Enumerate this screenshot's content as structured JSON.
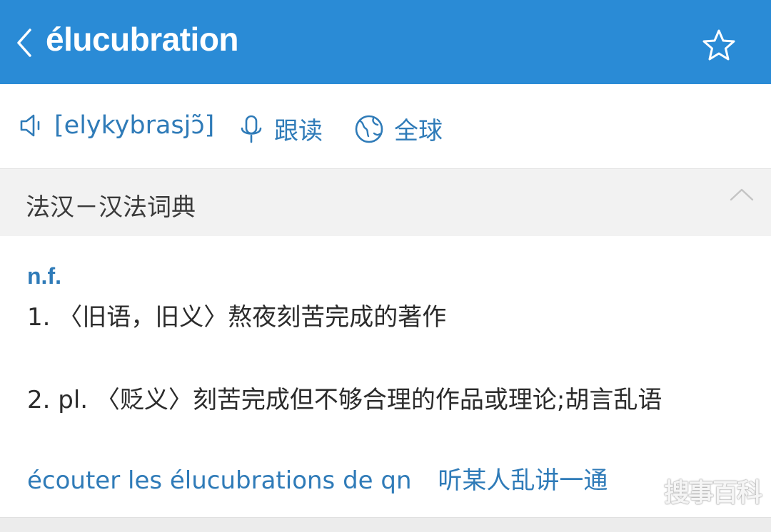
{
  "header": {
    "title": "élucubration",
    "back_icon": "chevron-left-icon",
    "star_icon": "star-outline-icon",
    "bg_color": "#2a8bd6"
  },
  "pronunciation": {
    "speaker_icon": "speaker-icon",
    "phonetic": "[elykybrasjɔ̃]",
    "follow_read_label": "跟读",
    "global_label": "全球",
    "accent_color": "#2f7bb8"
  },
  "section": {
    "title": "法汉－汉法词典"
  },
  "entry": {
    "pos": "n.f.",
    "definitions": [
      "1. 〈旧语，旧义〉熬夜刻苦完成的著作",
      "2. pl. 〈贬义〉刻苦完成但不够合理的作品或理论;胡言乱语"
    ],
    "example": {
      "fr": "écouter les élucubrations de qn",
      "zh": "听某人乱讲一通"
    }
  },
  "watermark": "搜事百科"
}
